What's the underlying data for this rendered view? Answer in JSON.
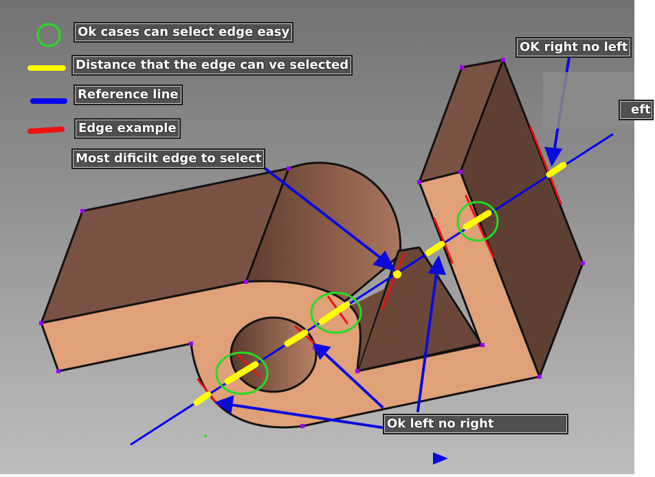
{
  "legend": {
    "ok_cases": "Ok cases can select edge easy",
    "distance": "Distance that the edge can ve selected",
    "reference": "Reference line",
    "edge_example": "Edge example"
  },
  "callouts": {
    "most_difficult": "Most dificilt edge to select",
    "ok_right_no_left": "OK right no left",
    "ok_left_no_right": "Ok left no right",
    "partial_hidden": "eft"
  },
  "colors": {
    "ok_circle": "#22dd22",
    "distance": "#ffff00",
    "reference": "#0000ee",
    "edge": "#ee1111",
    "face_light": "#e0a078",
    "face_dark": "#6e4a3a",
    "vertex": "#9b00ff"
  }
}
